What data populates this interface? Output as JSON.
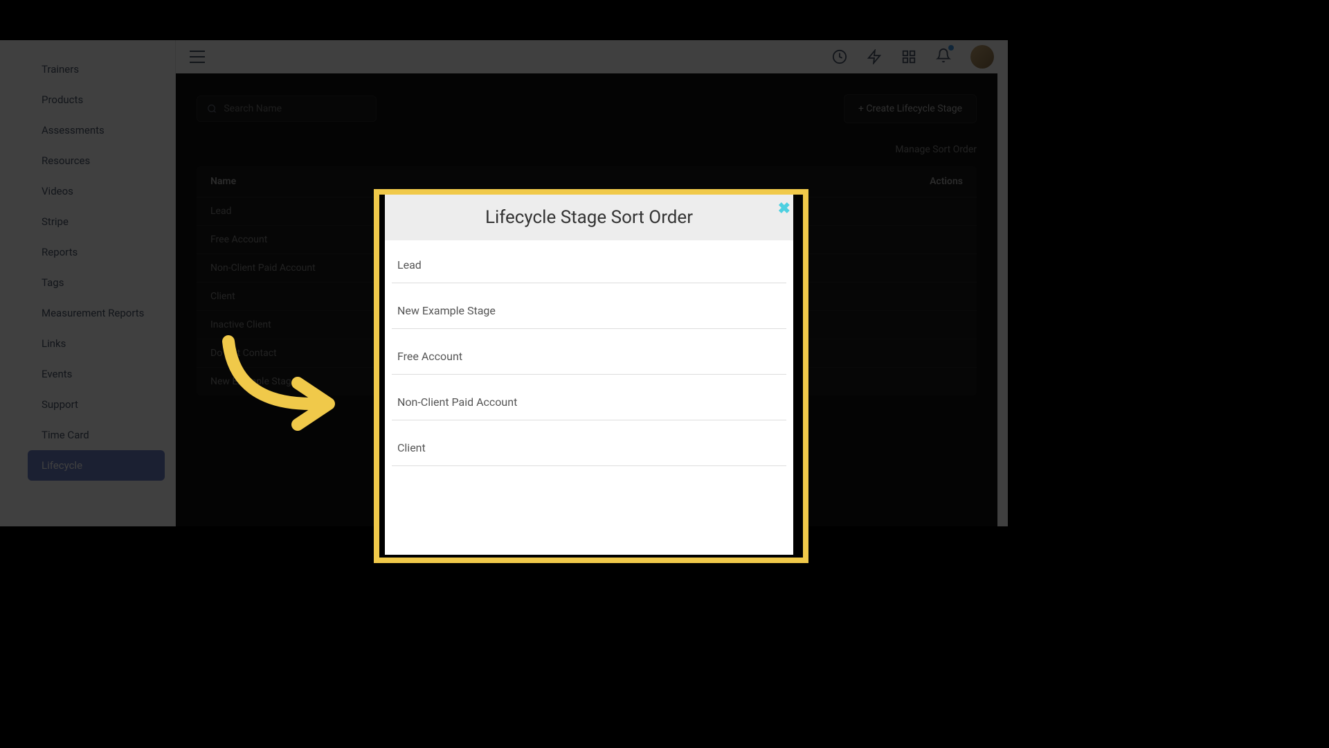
{
  "sidebar": {
    "items": [
      {
        "label": "Trainers"
      },
      {
        "label": "Products"
      },
      {
        "label": "Assessments"
      },
      {
        "label": "Resources"
      },
      {
        "label": "Videos"
      },
      {
        "label": "Stripe"
      },
      {
        "label": "Reports"
      },
      {
        "label": "Tags"
      },
      {
        "label": "Measurement Reports"
      },
      {
        "label": "Links"
      },
      {
        "label": "Events"
      },
      {
        "label": "Support"
      },
      {
        "label": "Time Card"
      },
      {
        "label": "Lifecycle"
      }
    ],
    "active_index": 13
  },
  "search": {
    "placeholder": "Search Name"
  },
  "buttons": {
    "create": "+ Create Lifecycle Stage",
    "manage": "Manage Sort Order"
  },
  "table": {
    "col_name": "Name",
    "col_actions": "Actions",
    "rows": [
      {
        "name": "Lead"
      },
      {
        "name": "Free Account"
      },
      {
        "name": "Non-Client Paid Account"
      },
      {
        "name": "Client"
      },
      {
        "name": "Inactive Client"
      },
      {
        "name": "Do Not Contact"
      },
      {
        "name": "New Example Stage"
      }
    ]
  },
  "modal": {
    "title": "Lifecycle Stage Sort Order",
    "close": "✖",
    "stages": [
      {
        "label": "Lead"
      },
      {
        "label": "New Example Stage"
      },
      {
        "label": "Free Account"
      },
      {
        "label": "Non-Client Paid Account"
      },
      {
        "label": "Client"
      }
    ]
  }
}
